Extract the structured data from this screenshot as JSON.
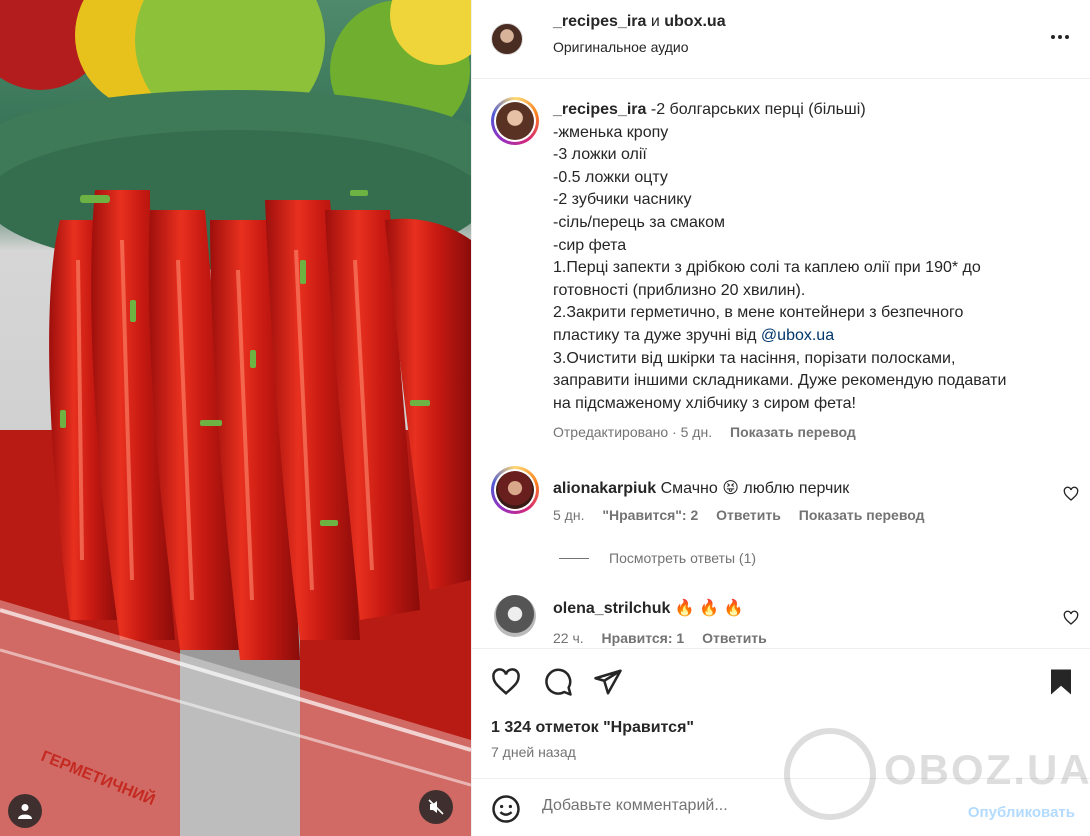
{
  "header": {
    "user1": "_recipes_ira",
    "and_word": "и",
    "user2": "ubox.ua",
    "audio": "Оригинальное аудио"
  },
  "caption": {
    "username": "_recipes_ira",
    "lines": [
      "-2 болгарських перці (більші)",
      "-жменька кропу",
      "-3 ложки олії",
      "-0.5 ложки оцту",
      "-2 зубчики часнику",
      "-сіль/перець за смаком",
      "-сир фета",
      "1.Перці запекти з дрібкою солі та каплею олії при 190* до",
      "готовності (приблизно 20 хвилин).",
      "2.Закрити герметично, в мене контейнери з безпечного",
      "пластику та дуже зручні від",
      "3.Очистити від шкірки та насіння, порізати полосками,",
      "заправити іншими складниками. Дуже рекомендую подавати",
      "на підсмаженому хлібчику з сиром фета!"
    ],
    "mention": "@ubox.ua",
    "edited": "Отредактировано · 5 дн.",
    "translate": "Показать перевод"
  },
  "comments": [
    {
      "username": "alionakarpiuk",
      "text": "Смачно 😝 люблю перчик",
      "age": "5 дн.",
      "likes": "\"Нравится\": 2",
      "reply": "Ответить",
      "translate": "Показать перевод",
      "view_replies": "Посмотреть ответы (1)"
    },
    {
      "username": "olena_strilchuk",
      "text": "🔥 🔥 🔥",
      "age": "22 ч.",
      "likes": "Нравится: 1",
      "reply": "Ответить"
    }
  ],
  "footer": {
    "likes": "1 324 отметок \"Нравится\"",
    "date": "7 дней назад",
    "comment_placeholder": "Добавьте комментарий...",
    "publish": "Опубликовать"
  },
  "media": {
    "container_text": "ГЕРМЕТИЧНИЙ"
  },
  "watermark": "OBOZ.UA",
  "colors": {
    "text": "#262626",
    "secondary": "#737373",
    "link": "#00376b",
    "publish_disabled": "#b3dbff",
    "pepper": "#d71f18"
  }
}
